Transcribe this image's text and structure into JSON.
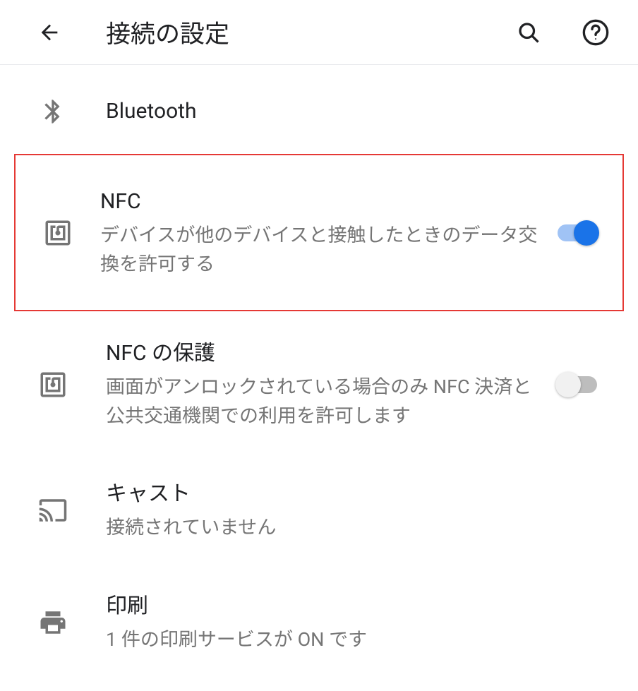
{
  "header": {
    "title": "接続の設定"
  },
  "items": [
    {
      "title": "Bluetooth",
      "subtitle": null,
      "toggle": null
    },
    {
      "title": "NFC",
      "subtitle": "デバイスが他のデバイスと接触したときのデータ交換を許可する",
      "toggle": "on"
    },
    {
      "title": "NFC の保護",
      "subtitle": "画面がアンロックされている場合のみ NFC 決済と公共交通機関での利用を許可します",
      "toggle": "off"
    },
    {
      "title": "キャスト",
      "subtitle": "接続されていません",
      "toggle": null
    },
    {
      "title": "印刷",
      "subtitle": "1 件の印刷サービスが ON です",
      "toggle": null
    }
  ]
}
